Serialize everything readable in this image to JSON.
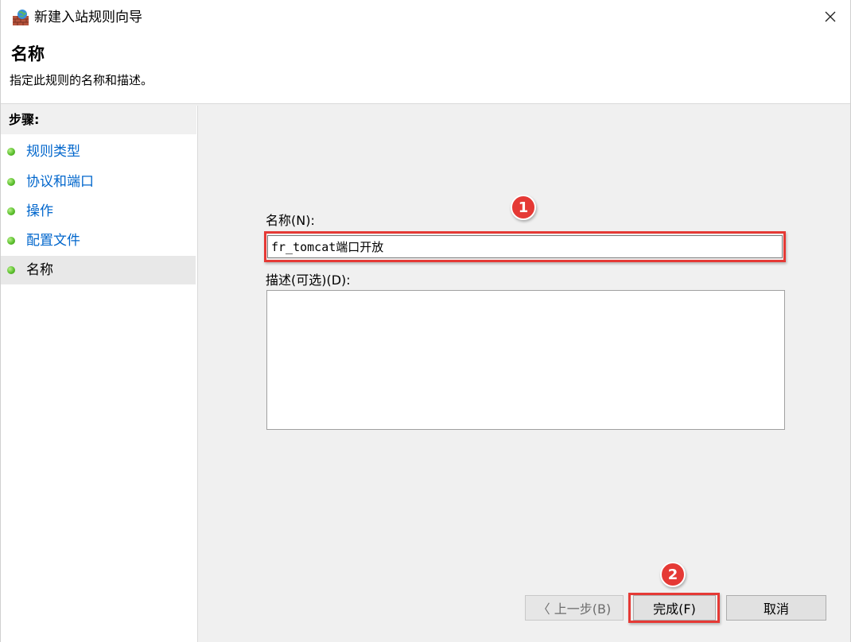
{
  "window": {
    "title": "新建入站规则向导",
    "icon": "firewall-icon"
  },
  "header": {
    "title": "名称",
    "subtitle": "指定此规则的名称和描述。"
  },
  "steps": {
    "header": "步骤:",
    "items": [
      {
        "label": "规则类型",
        "active": false
      },
      {
        "label": "协议和端口",
        "active": false
      },
      {
        "label": "操作",
        "active": false
      },
      {
        "label": "配置文件",
        "active": false
      },
      {
        "label": "名称",
        "active": true
      }
    ]
  },
  "form": {
    "name_label": "名称(N):",
    "name_value": "fr_tomcat端口开放",
    "description_label": "描述(可选)(D):",
    "description_value": ""
  },
  "buttons": {
    "back": "〈 上一步(B)",
    "finish": "完成(F)",
    "cancel": "取消"
  },
  "annotations": {
    "badge_1": "1",
    "badge_2": "2",
    "highlight_color": "#e53935"
  }
}
